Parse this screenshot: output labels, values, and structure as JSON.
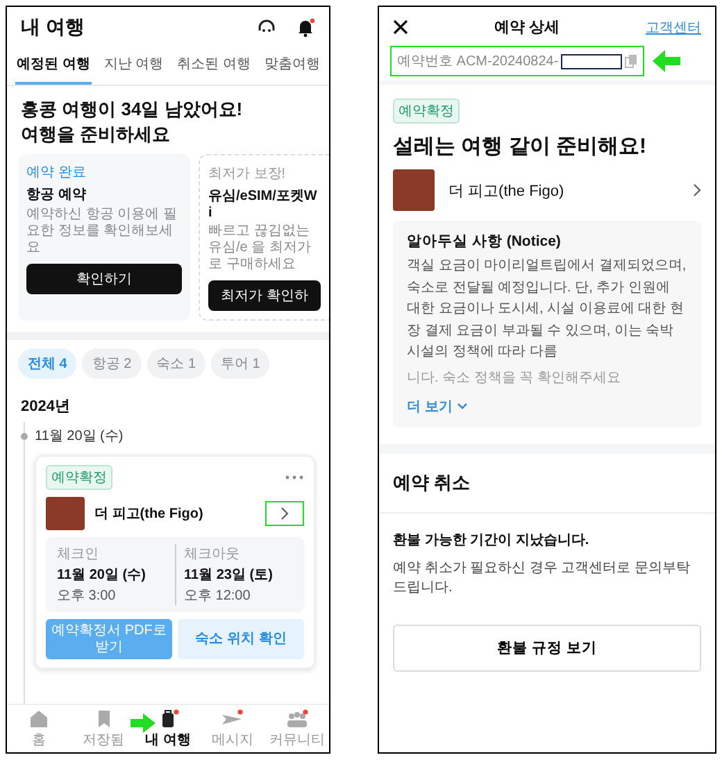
{
  "left": {
    "title": "내 여행",
    "tabs": [
      {
        "label": "예정된 여행",
        "selected": true
      },
      {
        "label": "지난 여행",
        "selected": false
      },
      {
        "label": "취소된 여행",
        "selected": false
      },
      {
        "label": "맞춤여행",
        "selected": false
      }
    ],
    "banner": [
      "홍콩 여행이 34일 남았어요!",
      "여행을 준비하세요"
    ],
    "promos": [
      {
        "tag": "예약 완료",
        "kind": "booked",
        "title": "항공 예약",
        "desc": "예약하신 항공 이용에 필요한 정보를 확인해보세요",
        "button": "확인하기"
      },
      {
        "tag": "최저가 보장!",
        "kind": "promo",
        "title": "유심/eSIM/포켓Wi",
        "desc": "빠르고 끊김없는 유심/e 을 최저가로 구매하세요",
        "button": "최저가 확인하"
      }
    ],
    "filters": [
      {
        "label": "전체 4",
        "selected": true
      },
      {
        "label": "항공 2",
        "selected": false
      },
      {
        "label": "숙소 1",
        "selected": false
      },
      {
        "label": "투어 1",
        "selected": false
      }
    ],
    "year": "2024년",
    "date": "11월 20일 (수)",
    "booking": {
      "status": "예약확정",
      "name": "더 피고(the Figo)",
      "stays": [
        {
          "label": "체크인",
          "date": "11월 20일 (수)",
          "time": "오후 3:00"
        },
        {
          "label": "체크아웃",
          "date": "11월 23일 (토)",
          "time": "오후 12:00"
        }
      ],
      "buttons": [
        {
          "label": "예약확정서 PDF로 받기",
          "kind": "primary"
        },
        {
          "label": "숙소 위치 확인",
          "kind": "secondary"
        }
      ]
    },
    "nav": [
      {
        "label": "홈",
        "kind": "home",
        "selected": false,
        "badge": false
      },
      {
        "label": "저장됨",
        "kind": "bookmark",
        "selected": false,
        "badge": false
      },
      {
        "label": "내 여행",
        "kind": "suitcase",
        "selected": true,
        "badge": true
      },
      {
        "label": "메시지",
        "kind": "plane",
        "selected": false,
        "badge": true
      },
      {
        "label": "커뮤니티",
        "kind": "people",
        "selected": false,
        "badge": true
      }
    ]
  },
  "right": {
    "title": "예약 상세",
    "help": "고객센터",
    "booking_number": "예약번호 ACM-20240824-",
    "status": "예약확정",
    "heading": "설레는 여행 같이 준비해요!",
    "hotel": "더 피고(the Figo)",
    "notice": {
      "title": "알아두실 사항 (Notice)",
      "body": "객실 요금이 마이리얼트립에서 결제되었으며, 숙소로 전달될 예정입니다. 단, 추가 인원에 대한 요금이나 도시세, 시설 이용료에 대한 현장 결제 요금이 부과될 수 있으며, 이는 숙박 시설의 정책에 따라 다름",
      "faded": "니다. 숙소 정책을 꼭 확인해주세요",
      "more": "더 보기"
    },
    "cancel": {
      "title": "예약 취소",
      "subtitle": "환불 가능한 기간이 지났습니다.",
      "desc": "예약 취소가 필요하신 경우 고객센터로 문의부탁드립니다.",
      "button": "환불 규정 보기"
    }
  }
}
